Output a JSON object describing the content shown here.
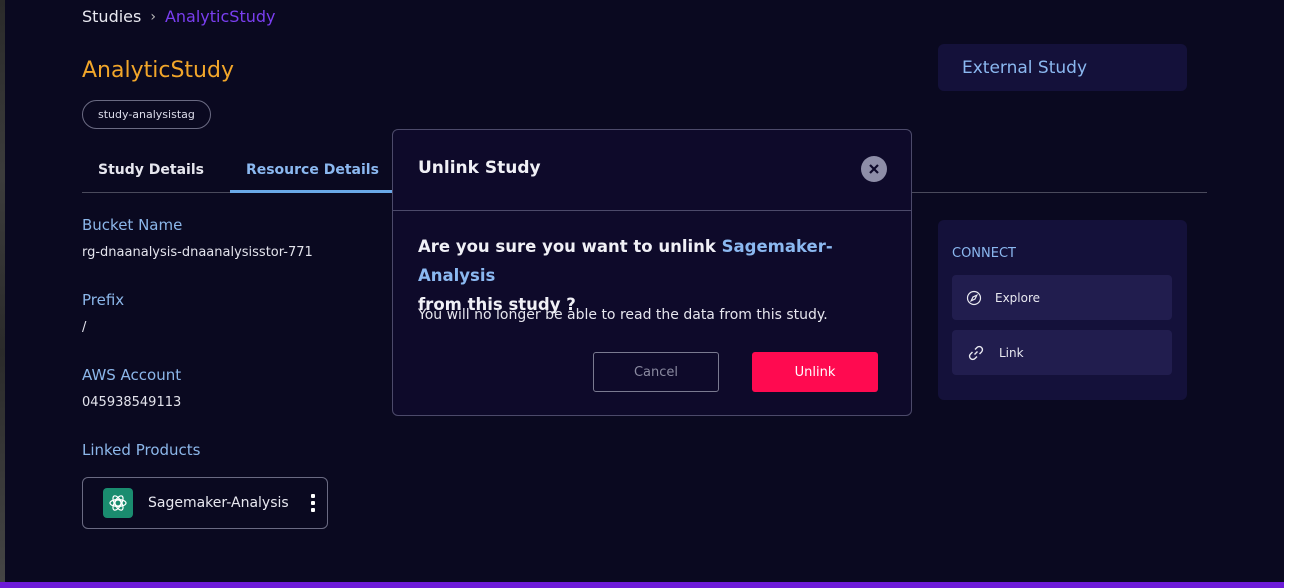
{
  "breadcrumb": {
    "root": "Studies",
    "separator": "›",
    "current": "AnalyticStudy"
  },
  "study": {
    "title": "AnalyticStudy",
    "tag": "study-analysistag"
  },
  "tabs": [
    {
      "label": "Study Details"
    },
    {
      "label": "Resource Details",
      "active": true
    }
  ],
  "details": {
    "bucket_label": "Bucket Name",
    "bucket_value": "rg-dnaanalysis-dnaanalysisstor-771",
    "prefix_label": "Prefix",
    "prefix_value": "/",
    "account_label": "AWS Account",
    "account_value": "045938549113",
    "linked_label": "Linked Products"
  },
  "linked_product": {
    "name": "Sagemaker-Analysis",
    "icon": "openai-knot-icon"
  },
  "side": {
    "external_study": "External Study",
    "connect_title": "CONNECT",
    "explore_label": "Explore",
    "link_label": "Link"
  },
  "modal": {
    "title": "Unlink Study",
    "question_prefix": "Are you sure you want to unlink ",
    "question_product": "Sagemaker-Analysis",
    "question_suffix": "from this study ?",
    "warning": "You will no longer be able to read the data from this study.",
    "cancel_label": "Cancel",
    "unlink_label": "Unlink"
  },
  "colors": {
    "background": "#0a0920",
    "title_accent": "#f2a62a",
    "link_accent": "#8bb8f0",
    "danger": "#ff0a50",
    "brand_bar": "#6d1bd8"
  }
}
